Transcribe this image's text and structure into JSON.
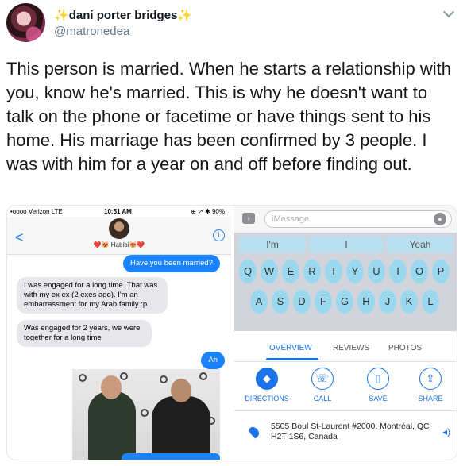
{
  "tweet": {
    "display_name": "dani porter bridges",
    "handle": "@matronedea",
    "text": "This person is married. When he starts a relationship with you, know he's married. This is why he doesn't want to talk on the phone or facetime or have things sent to his home. His marriage has been confirmed by 3 people. I was with him for a year on and off before finding out."
  },
  "messages_screen": {
    "carrier": "•oooo Verizon  LTE",
    "time": "10:51 AM",
    "status_right": "⊕ ↗ ✱ 90%",
    "contact_name": "❤️😻 Habibi😻❤️",
    "bubbles": [
      {
        "dir": "out",
        "text": "Have you been married?"
      },
      {
        "dir": "in",
        "text": "I was engaged for a long time. That was with my ex ex (2 exes ago). I'm an embarrassment for my Arab family :p"
      },
      {
        "dir": "in",
        "text": "Was engaged for 2 years, we were together for a long time"
      },
      {
        "dir": "out",
        "text": "Ah"
      }
    ]
  },
  "keyboard_screen": {
    "input_placeholder": "iMessage",
    "suggestions": [
      "I'm",
      "I",
      "Yeah"
    ],
    "row1": [
      "Q",
      "W",
      "E",
      "R",
      "T",
      "Y",
      "U",
      "I",
      "O",
      "P"
    ],
    "row2": [
      "A",
      "S",
      "D",
      "F",
      "G",
      "H",
      "J",
      "K",
      "L"
    ]
  },
  "maps_panel": {
    "tabs": [
      "OVERVIEW",
      "REVIEWS",
      "PHOTOS"
    ],
    "actions": [
      "DIRECTIONS",
      "CALL",
      "SAVE",
      "SHARE"
    ],
    "address": "5505 Boul St-Laurent #2000, Montréal, QC H2T 1S6, Canada"
  }
}
